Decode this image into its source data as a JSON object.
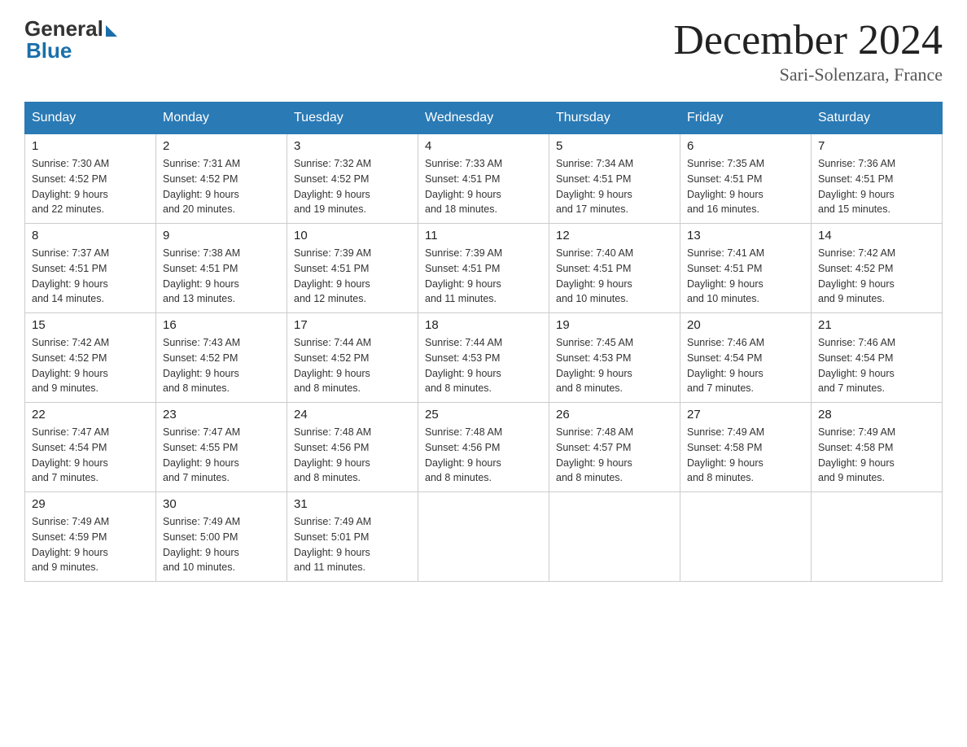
{
  "header": {
    "logo_general": "General",
    "logo_blue": "Blue",
    "month_title": "December 2024",
    "subtitle": "Sari-Solenzara, France"
  },
  "weekdays": [
    "Sunday",
    "Monday",
    "Tuesday",
    "Wednesday",
    "Thursday",
    "Friday",
    "Saturday"
  ],
  "weeks": [
    [
      {
        "day": "1",
        "info": "Sunrise: 7:30 AM\nSunset: 4:52 PM\nDaylight: 9 hours\nand 22 minutes."
      },
      {
        "day": "2",
        "info": "Sunrise: 7:31 AM\nSunset: 4:52 PM\nDaylight: 9 hours\nand 20 minutes."
      },
      {
        "day": "3",
        "info": "Sunrise: 7:32 AM\nSunset: 4:52 PM\nDaylight: 9 hours\nand 19 minutes."
      },
      {
        "day": "4",
        "info": "Sunrise: 7:33 AM\nSunset: 4:51 PM\nDaylight: 9 hours\nand 18 minutes."
      },
      {
        "day": "5",
        "info": "Sunrise: 7:34 AM\nSunset: 4:51 PM\nDaylight: 9 hours\nand 17 minutes."
      },
      {
        "day": "6",
        "info": "Sunrise: 7:35 AM\nSunset: 4:51 PM\nDaylight: 9 hours\nand 16 minutes."
      },
      {
        "day": "7",
        "info": "Sunrise: 7:36 AM\nSunset: 4:51 PM\nDaylight: 9 hours\nand 15 minutes."
      }
    ],
    [
      {
        "day": "8",
        "info": "Sunrise: 7:37 AM\nSunset: 4:51 PM\nDaylight: 9 hours\nand 14 minutes."
      },
      {
        "day": "9",
        "info": "Sunrise: 7:38 AM\nSunset: 4:51 PM\nDaylight: 9 hours\nand 13 minutes."
      },
      {
        "day": "10",
        "info": "Sunrise: 7:39 AM\nSunset: 4:51 PM\nDaylight: 9 hours\nand 12 minutes."
      },
      {
        "day": "11",
        "info": "Sunrise: 7:39 AM\nSunset: 4:51 PM\nDaylight: 9 hours\nand 11 minutes."
      },
      {
        "day": "12",
        "info": "Sunrise: 7:40 AM\nSunset: 4:51 PM\nDaylight: 9 hours\nand 10 minutes."
      },
      {
        "day": "13",
        "info": "Sunrise: 7:41 AM\nSunset: 4:51 PM\nDaylight: 9 hours\nand 10 minutes."
      },
      {
        "day": "14",
        "info": "Sunrise: 7:42 AM\nSunset: 4:52 PM\nDaylight: 9 hours\nand 9 minutes."
      }
    ],
    [
      {
        "day": "15",
        "info": "Sunrise: 7:42 AM\nSunset: 4:52 PM\nDaylight: 9 hours\nand 9 minutes."
      },
      {
        "day": "16",
        "info": "Sunrise: 7:43 AM\nSunset: 4:52 PM\nDaylight: 9 hours\nand 8 minutes."
      },
      {
        "day": "17",
        "info": "Sunrise: 7:44 AM\nSunset: 4:52 PM\nDaylight: 9 hours\nand 8 minutes."
      },
      {
        "day": "18",
        "info": "Sunrise: 7:44 AM\nSunset: 4:53 PM\nDaylight: 9 hours\nand 8 minutes."
      },
      {
        "day": "19",
        "info": "Sunrise: 7:45 AM\nSunset: 4:53 PM\nDaylight: 9 hours\nand 8 minutes."
      },
      {
        "day": "20",
        "info": "Sunrise: 7:46 AM\nSunset: 4:54 PM\nDaylight: 9 hours\nand 7 minutes."
      },
      {
        "day": "21",
        "info": "Sunrise: 7:46 AM\nSunset: 4:54 PM\nDaylight: 9 hours\nand 7 minutes."
      }
    ],
    [
      {
        "day": "22",
        "info": "Sunrise: 7:47 AM\nSunset: 4:54 PM\nDaylight: 9 hours\nand 7 minutes."
      },
      {
        "day": "23",
        "info": "Sunrise: 7:47 AM\nSunset: 4:55 PM\nDaylight: 9 hours\nand 7 minutes."
      },
      {
        "day": "24",
        "info": "Sunrise: 7:48 AM\nSunset: 4:56 PM\nDaylight: 9 hours\nand 8 minutes."
      },
      {
        "day": "25",
        "info": "Sunrise: 7:48 AM\nSunset: 4:56 PM\nDaylight: 9 hours\nand 8 minutes."
      },
      {
        "day": "26",
        "info": "Sunrise: 7:48 AM\nSunset: 4:57 PM\nDaylight: 9 hours\nand 8 minutes."
      },
      {
        "day": "27",
        "info": "Sunrise: 7:49 AM\nSunset: 4:58 PM\nDaylight: 9 hours\nand 8 minutes."
      },
      {
        "day": "28",
        "info": "Sunrise: 7:49 AM\nSunset: 4:58 PM\nDaylight: 9 hours\nand 9 minutes."
      }
    ],
    [
      {
        "day": "29",
        "info": "Sunrise: 7:49 AM\nSunset: 4:59 PM\nDaylight: 9 hours\nand 9 minutes."
      },
      {
        "day": "30",
        "info": "Sunrise: 7:49 AM\nSunset: 5:00 PM\nDaylight: 9 hours\nand 10 minutes."
      },
      {
        "day": "31",
        "info": "Sunrise: 7:49 AM\nSunset: 5:01 PM\nDaylight: 9 hours\nand 11 minutes."
      },
      {
        "day": "",
        "info": ""
      },
      {
        "day": "",
        "info": ""
      },
      {
        "day": "",
        "info": ""
      },
      {
        "day": "",
        "info": ""
      }
    ]
  ]
}
